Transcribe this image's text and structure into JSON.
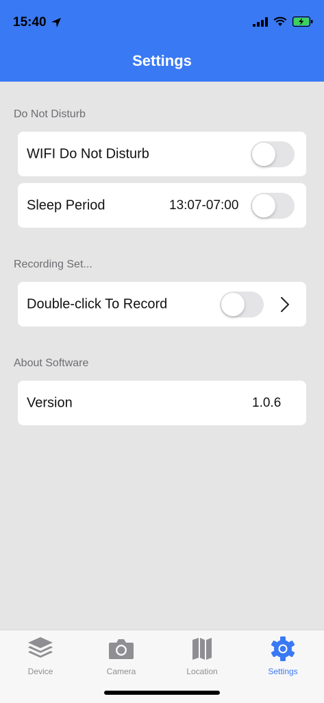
{
  "status_bar": {
    "time": "15:40"
  },
  "header": {
    "title": "Settings"
  },
  "sections": {
    "dnd": {
      "label": "Do Not Disturb",
      "wifi_label": "WIFI Do Not Disturb",
      "wifi_on": false,
      "sleep_label": "Sleep Period",
      "sleep_value": "13:07-07:00",
      "sleep_on": false
    },
    "recording": {
      "label": "Recording Set...",
      "double_click_label": "Double-click To Record",
      "double_click_on": false
    },
    "about": {
      "label": "About Software",
      "version_label": "Version",
      "version_value": "1.0.6"
    }
  },
  "tabs": [
    {
      "label": "Device",
      "icon": "layers-icon",
      "active": false
    },
    {
      "label": "Camera",
      "icon": "camera-icon",
      "active": false
    },
    {
      "label": "Location",
      "icon": "map-icon",
      "active": false
    },
    {
      "label": "Settings",
      "icon": "gear-icon",
      "active": true
    }
  ],
  "colors": {
    "accent": "#3a79f4",
    "background": "#e5e5e5",
    "inactive_tab": "#8e8e93"
  }
}
